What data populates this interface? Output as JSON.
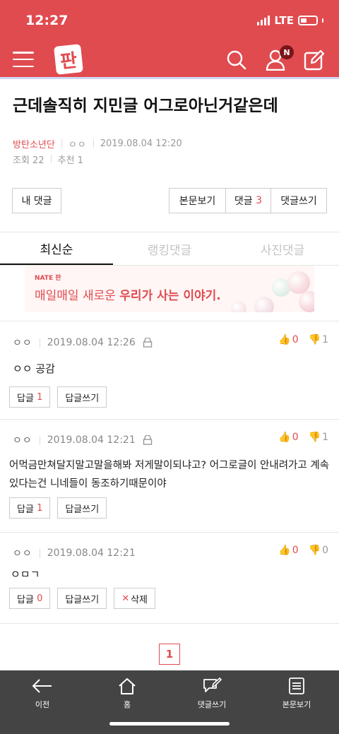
{
  "status_bar": {
    "time": "12:27",
    "network": "LTE"
  },
  "header": {
    "logo_text": "판",
    "notification_badge": "N"
  },
  "post": {
    "title": "근데솔직히 지민글 어그로아닌거같은데",
    "author": "방탄소년단",
    "nickname": "ㅇㅇ",
    "datetime": "2019.08.04 12:20",
    "views_label": "조회 22",
    "recommend_label": "추천 1"
  },
  "actions": {
    "my_comments": "내 댓글",
    "view_post": "본문보기",
    "comments_label": "댓글",
    "comments_count": "3",
    "write_comment": "댓글쓰기"
  },
  "tabs": [
    "최신순",
    "랭킹댓글",
    "사진댓글"
  ],
  "ad": {
    "brand": "NATE 판",
    "text_plain": "매일매일 새로운 ",
    "text_bold": "우리가 사는 이야기."
  },
  "comments": [
    {
      "nick": "ㅇㅇ",
      "datetime": "2019.08.04 12:26",
      "up": "0",
      "down": "1",
      "body": "ㅇㅇ 공감",
      "reply_label": "답글",
      "reply_count": "1",
      "write_reply": "답글쓰기"
    },
    {
      "nick": "ㅇㅇ",
      "datetime": "2019.08.04 12:21",
      "up": "0",
      "down": "1",
      "body": "어먹금만쳐달지말고말을해봐 저게말이되냐고? 어그로글이 안내려가고 계속있다는건 니네들이 동조하기때문이야",
      "reply_label": "답글",
      "reply_count": "1",
      "write_reply": "답글쓰기"
    },
    {
      "nick": "ㅇㅇ",
      "datetime": "2019.08.04 12:21",
      "up": "0",
      "down": "0",
      "body": "ㅇㅁㄱ",
      "reply_label": "답글",
      "reply_count": "0",
      "write_reply": "답글쓰기",
      "delete_label": "삭제"
    }
  ],
  "pagination": {
    "current": "1"
  },
  "bottom_nav": [
    "이전",
    "홈",
    "댓글쓰기",
    "본문보기"
  ],
  "colors": {
    "brand": "#e04b50",
    "bottom_bar": "#444444"
  }
}
